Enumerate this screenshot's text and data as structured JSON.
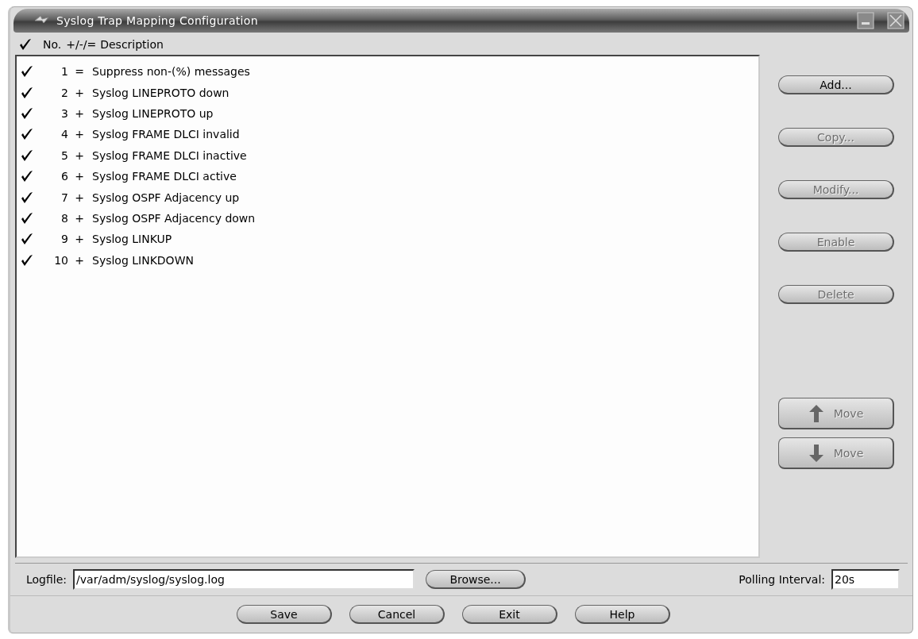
{
  "window": {
    "title": "Syslog Trap Mapping Configuration"
  },
  "header": {
    "checked": true,
    "number": "No.",
    "op": "+/-/=",
    "description": "Description"
  },
  "rows": [
    {
      "checked": true,
      "number": "1",
      "op": "=",
      "description": "Suppress non-(%) messages"
    },
    {
      "checked": true,
      "number": "2",
      "op": "+",
      "description": "Syslog LINEPROTO down"
    },
    {
      "checked": true,
      "number": "3",
      "op": "+",
      "description": "Syslog LINEPROTO up"
    },
    {
      "checked": true,
      "number": "4",
      "op": "+",
      "description": "Syslog FRAME DLCI invalid"
    },
    {
      "checked": true,
      "number": "5",
      "op": "+",
      "description": "Syslog FRAME DLCI inactive"
    },
    {
      "checked": true,
      "number": "6",
      "op": "+",
      "description": "Syslog FRAME DLCI active"
    },
    {
      "checked": true,
      "number": "7",
      "op": "+",
      "description": "Syslog OSPF Adjacency up"
    },
    {
      "checked": true,
      "number": "8",
      "op": "+",
      "description": "Syslog OSPF Adjacency down"
    },
    {
      "checked": true,
      "number": "9",
      "op": "+",
      "description": "Syslog LINKUP"
    },
    {
      "checked": true,
      "number": "10",
      "op": "+",
      "description": "Syslog LINKDOWN"
    }
  ],
  "side_buttons": [
    {
      "label": "Add...",
      "disabled": false
    },
    {
      "label": "Copy...",
      "disabled": true
    },
    {
      "label": "Modify...",
      "disabled": true
    },
    {
      "label": "Enable",
      "disabled": true
    },
    {
      "label": "Delete",
      "disabled": true
    }
  ],
  "move_buttons": [
    {
      "kind": "up",
      "label": "Move",
      "disabled": true
    },
    {
      "kind": "down",
      "label": "Move",
      "disabled": true
    }
  ],
  "logfile": {
    "label": "Logfile:",
    "value": "/var/adm/syslog/syslog.log",
    "browse": "Browse..."
  },
  "polling": {
    "label": "Polling Interval:",
    "value": "20s"
  },
  "footer_buttons": [
    {
      "label": "Save"
    },
    {
      "label": "Cancel"
    },
    {
      "label": "Exit"
    },
    {
      "label": "Help"
    }
  ]
}
